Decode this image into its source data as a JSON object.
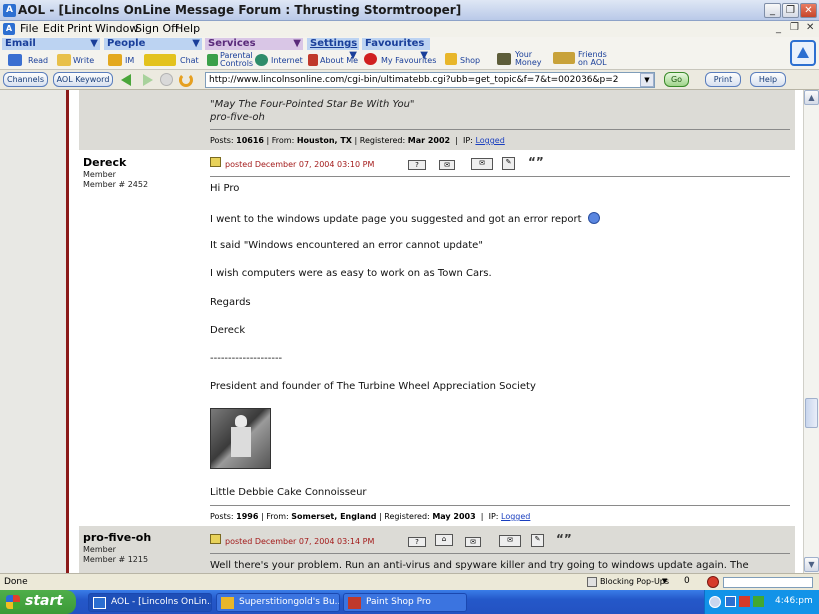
{
  "window": {
    "title": "AOL - [Lincolns OnLine Message Forum : Thrusting Stormtrooper]"
  },
  "menubar": {
    "items": [
      "File",
      "Edit",
      "Print",
      "Window",
      "Sign Off",
      "Help"
    ]
  },
  "toolbar": {
    "groups": [
      {
        "label": "Email",
        "items": [
          "Read",
          "Write"
        ]
      },
      {
        "label": "People",
        "items": [
          "IM",
          "Chat"
        ]
      },
      {
        "label": "Services",
        "items": [
          "Parental Controls",
          "Internet",
          "About Me"
        ]
      },
      {
        "label": "Settings",
        "items": [
          "My Favourites"
        ]
      },
      {
        "label": "Favourites",
        "items": [
          "Shop",
          "Your Money",
          "Friends on AOL"
        ]
      }
    ]
  },
  "addressbar": {
    "channels": "Channels",
    "keyword": "AOL Keyword",
    "url": "http://www.lincolnsonline.com/cgi-bin/ultimatebb.cgi?ubb=get_topic&f=7&t=002036&p=2",
    "go": "Go",
    "print": "Print",
    "help": "Help"
  },
  "prev_post": {
    "sig_line1": "\"May The Four-Pointed Star Be With You\"",
    "sig_line2": "pro-five-oh",
    "posts_label": "Posts:",
    "posts": "10616",
    "from_label": "From:",
    "from": "Houston, TX",
    "registered_label": "Registered:",
    "registered": "Mar 2002",
    "ip_label": "IP:",
    "ip": "Logged"
  },
  "post1": {
    "username": "Dereck",
    "role": "Member",
    "member_no": "Member # 2452",
    "posted": "posted December 07, 2004 03:10 PM",
    "lines": [
      "Hi Pro",
      "I went to the windows update page you suggested and got an error report",
      "It said \"Windows encountered an error cannot update\"",
      "I wish computers were as easy to work on as Town Cars.",
      "Regards",
      "Dereck",
      "--------------------",
      "President and founder of The Turbine Wheel Appreciation Society",
      "Little Debbie Cake Connoisseur"
    ],
    "posts_label": "Posts:",
    "posts": "1996",
    "from_label": "From:",
    "from": "Somerset, England",
    "registered_label": "Registered:",
    "registered": "May 2003",
    "ip_label": "IP:",
    "ip": "Logged"
  },
  "post2": {
    "username": "pro-five-oh",
    "role": "Member",
    "member_no": "Member # 1215",
    "posted": "posted December 07, 2004 03:14 PM",
    "line1": "Well there's your problem. Run an anti-virus and spyware killer and try going to windows update again. The"
  },
  "statusbar": {
    "text": "Done",
    "popups": "Blocking Pop-Ups",
    "count": "0"
  },
  "taskbar": {
    "start": "start",
    "tasks": [
      "AOL - [Lincolns OnLin...",
      "Superstitiongold's Bu...",
      "Paint Shop Pro"
    ],
    "clock": "4:46:pm"
  },
  "colors": {
    "accent_red": "#a31b1b",
    "link_blue": "#1a3fbf",
    "sidebar_red": "#8b1a1a"
  }
}
